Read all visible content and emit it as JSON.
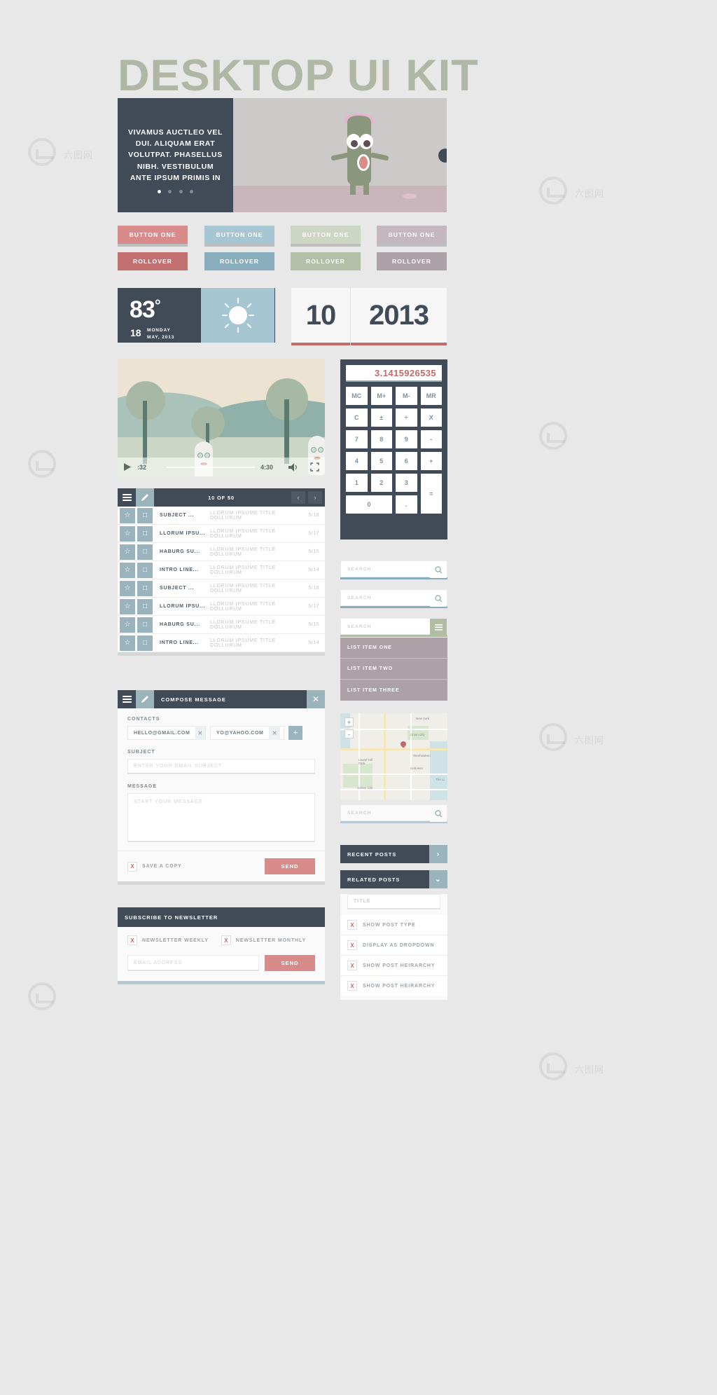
{
  "page": {
    "title": "DESKTOP UI KIT",
    "background": "#e8e8e8"
  },
  "colors": {
    "dark": "#414a57",
    "red": "#d98b8b",
    "red_dark": "#bf6b6b",
    "blue": "#a6c6d4",
    "blue_dark": "#8aadbd",
    "green": "#cdd6c3",
    "green_dark": "#b0bda4",
    "mauve": "#c4b7bd",
    "mauve_dark": "#ada1a8",
    "title_green": "#b0b7a5"
  },
  "hero": {
    "caption": "VIVAMUS AUCTLEO VEL DUI. ALIQUAM ERAT VOLUTPAT. PHASELLUS NIBH. VESTIBULUM ANTE IPSUM PRIMIS IN",
    "dots": 4,
    "active_dot": 1
  },
  "buttons": [
    {
      "label": "BUTTON ONE",
      "rollover": "ROLLOVER",
      "color": "#d98b8b",
      "rollover_color": "#c16f6f",
      "shadow": "#bf6b6b"
    },
    {
      "label": "BUTTON ONE",
      "rollover": "ROLLOVER",
      "color": "#a6c6d4",
      "rollover_color": "#8aadbd",
      "shadow": "#8aadbd"
    },
    {
      "label": "BUTTON ONE",
      "rollover": "ROLLOVER",
      "color": "#cdd6c3",
      "rollover_color": "#b3bfa6",
      "shadow": "#b0bda4"
    },
    {
      "label": "BUTTON ONE",
      "rollover": "ROLLOVER",
      "color": "#c4b7bd",
      "rollover_color": "#ada1a8",
      "shadow": "#ada1a8"
    }
  ],
  "weather": {
    "temperature": "83",
    "degree_symbol": "°",
    "day_number": "18",
    "weekday": "MONDAY",
    "date": "MAY, 2013",
    "icon": "sun-icon"
  },
  "calendar": {
    "day": "10",
    "year": "2013"
  },
  "video": {
    "play_icon": "play-icon",
    "elapsed": ":32",
    "duration": "4:30",
    "volume_icon": "volume-icon",
    "fullscreen_icon": "fullscreen-icon"
  },
  "calculator": {
    "display": "3.1415926535",
    "keys": [
      "MC",
      "M+",
      "M-",
      "MR",
      "C",
      "±",
      "÷",
      "X",
      "7",
      "8",
      "9",
      "-",
      "4",
      "5",
      "6",
      "+",
      "1",
      "2",
      "3",
      "=",
      "0",
      "."
    ]
  },
  "mail": {
    "menu_icon": "hamburger-icon",
    "compose_icon": "pencil-icon",
    "count": "10 OF 50",
    "prev_icon": "chevron-left-icon",
    "next_icon": "chevron-right-icon",
    "rows": [
      {
        "subject": "SUBJECT ...",
        "preview": "LLORUM IPSUME TITLE DOLLURUM",
        "date": "5/18"
      },
      {
        "subject": "LLORUM IPSU...",
        "preview": "LLORUM IPSUME TITLE DOLLURUM",
        "date": "5/17"
      },
      {
        "subject": "HABURG SU...",
        "preview": "LLORUM IPSUME TITLE DOLLURUM",
        "date": "5/15"
      },
      {
        "subject": "INTRO LINE...",
        "preview": "LLORUM IPSUME TITLE DOLLURUM",
        "date": "5/14"
      },
      {
        "subject": "SUBJECT ...",
        "preview": "LLORUM IPSUME TITLE DOLLURUM",
        "date": "5/18"
      },
      {
        "subject": "LLORUM IPSU...",
        "preview": "LLORUM IPSUME TITLE DOLLURUM",
        "date": "5/17"
      },
      {
        "subject": "HABURG SU...",
        "preview": "LLORUM IPSUME TITLE DOLLURUM",
        "date": "5/15"
      },
      {
        "subject": "INTRO LINE...",
        "preview": "LLORUM IPSUME TITLE DOLLURUM",
        "date": "5/14"
      }
    ]
  },
  "compose": {
    "menu_icon": "hamburger-icon",
    "edit_icon": "pencil-icon",
    "title": "COMPOSE MESSAGE",
    "close_icon": "close-icon",
    "contacts_label": "CONTACTS",
    "contacts": [
      "HELLO@GMAIL.COM",
      "YO@YAHOO.COM"
    ],
    "add_label": "+",
    "subject_label": "SUBJECT",
    "subject_placeholder": "ENTER YOUR EMAIL SUBJECT",
    "message_label": "MESSAGE",
    "message_placeholder": "START YOUR MESSAGE",
    "save_copy_label": "SAVE A COPY",
    "save_copy_mark": "X",
    "send_label": "SEND"
  },
  "newsletter": {
    "title": "SUBSCRIBE TO NEWSLETTER",
    "options": [
      {
        "mark": "X",
        "label": "NEWSLETTER WEEKLY"
      },
      {
        "mark": "X",
        "label": "NEWSLETTER MONTHLY"
      }
    ],
    "email_placeholder": "EMAIL ADDRESS",
    "send_label": "SEND"
  },
  "search_boxes": [
    {
      "placeholder": "SEARCH",
      "icon": "search-icon",
      "underline": "#8aadbd"
    },
    {
      "placeholder": "SEARCH",
      "icon": "search-icon",
      "underline": "#8aadbd"
    },
    {
      "placeholder": "SEARCH",
      "icon": "hamburger-icon",
      "underline": "#b0bda4"
    }
  ],
  "list_items": [
    "LIST ITEM ONE",
    "LIST ITEM TWO",
    "LIST ITEM THREE"
  ],
  "map": {
    "zoom_in": "+",
    "zoom_out": "-",
    "labels": [
      "New York",
      "Union City",
      "Weehawken",
      "Laurel Hill Park",
      "Hoboken",
      "Jersey City",
      "The Li"
    ],
    "search_placeholder": "SEARCH",
    "search_icon": "search-icon"
  },
  "posts": {
    "recent": {
      "title": "RECENT POSTS",
      "icon": "chevron-right-icon",
      "bar": "#414a57",
      "icon_bg": "#9bb3bc"
    },
    "related": {
      "title": "RELATED POSTS",
      "icon": "chevron-down-icon",
      "bar": "#414a57",
      "icon_bg": "#9bb3bc"
    },
    "title_placeholder": "TITLE",
    "options": [
      {
        "mark": "X",
        "label": "SHOW POST TYPE"
      },
      {
        "mark": "X",
        "label": "DISPLAY AS DROPDOWN"
      },
      {
        "mark": "X",
        "label": "SHOW POST HEIRARCHY"
      },
      {
        "mark": "X",
        "label": "SHOW POST HEIRARCHY"
      }
    ]
  },
  "watermark": {
    "text": "六图网"
  }
}
